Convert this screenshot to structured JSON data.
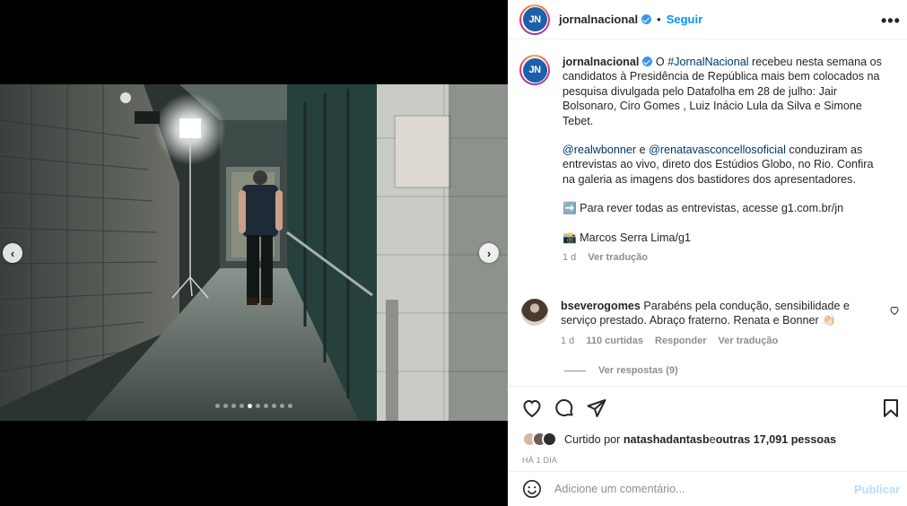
{
  "post": {
    "username": "jornalnacional",
    "avatar_initials": "JN",
    "follow_label": "Seguir",
    "separator": "•",
    "more_label": "•••",
    "carousel": {
      "total_slides": 10,
      "active_slide": 5,
      "prev_label": "‹",
      "next_label": "›"
    }
  },
  "caption": {
    "username": "jornalnacional",
    "text_1_pre": " O ",
    "hashtag": "#JornalNacional",
    "text_1_post": " recebeu nesta semana os candidatos à Presidência de República mais bem colocados na pesquisa divulgada pelo Datafolha em 28 de julho: Jair Bolsonaro, Ciro Gomes , Luiz Inácio Lula da Silva e Simone Tebet.",
    "mention_1": "@realwbonner",
    "mid_connector": " e ",
    "mention_2": "@renatavasconcellosoficial",
    "text_2": " conduziram as entrevistas ao vivo, direto dos Estúdios Globo, no Rio. Confira na galeria as imagens dos bastidores dos apresentadores.",
    "text_3": "➡️ Para rever todas as entrevistas, acesse g1.com.br/jn",
    "text_4": "📸 Marcos Serra Lima/g1",
    "time": "1 d",
    "translate": "Ver tradução"
  },
  "comment": {
    "username": "bseverogomes",
    "text": " Parabéns pela condução, sensibilidade e serviço prestado. Abraço fraterno. Renata e Bonner 👏🏻",
    "time": "1 d",
    "likes": "110 curtidas",
    "reply": "Responder",
    "translate": "Ver tradução",
    "view_replies": "Ver respostas (9)"
  },
  "likes": {
    "prefix": "Curtido por ",
    "user": "natashadantasb",
    "middle": " e ",
    "others": "outras 17,091 pessoas"
  },
  "date": "HÁ 1 DIA",
  "add_comment": {
    "placeholder": "Adicione um comentário...",
    "publish_label": "Publicar"
  },
  "colors": {
    "accent": "#0095f6",
    "link": "#00376b",
    "muted": "#8e8e8e",
    "publish_disabled": "#b2dffc"
  },
  "icons": {
    "like": "heart-outline-icon",
    "comment": "speech-bubble-icon",
    "share": "paper-plane-icon",
    "save": "bookmark-icon",
    "emoji": "smiley-icon",
    "comment_like": "small-heart-icon"
  }
}
